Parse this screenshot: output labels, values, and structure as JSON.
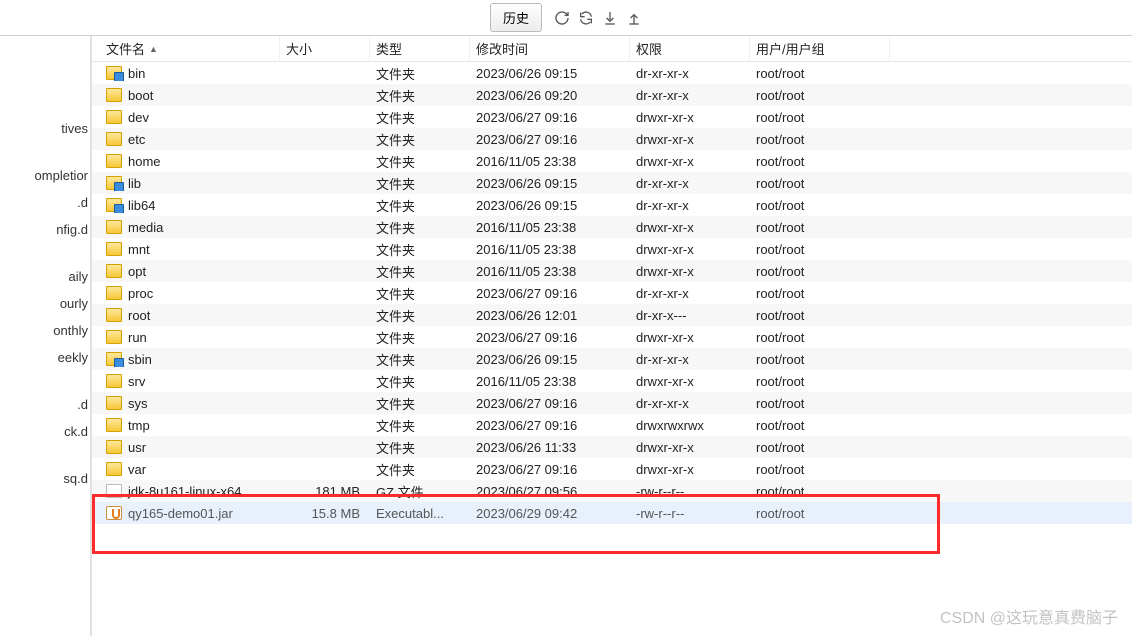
{
  "toolbar": {
    "history_label": "历史",
    "icons": [
      "refresh-icon",
      "sync-icon",
      "download-icon",
      "upload-icon"
    ]
  },
  "left_sidebar": {
    "items_top": [
      ""
    ],
    "items": [
      "tives",
      "",
      "ompletior",
      ".d",
      "nfig.d",
      "",
      "aily",
      "ourly",
      "onthly",
      "eekly",
      "",
      ".d",
      "ck.d",
      "",
      "sq.d"
    ]
  },
  "table": {
    "headers": {
      "name": "文件名",
      "size": "大小",
      "type": "类型",
      "date": "修改时间",
      "perm": "权限",
      "user": "用户/用户组"
    },
    "rows": [
      {
        "icon": "folder-link",
        "name": "bin",
        "size": "",
        "type": "文件夹",
        "date": "2023/06/26 09:15",
        "perm": "dr-xr-xr-x",
        "user": "root/root"
      },
      {
        "icon": "folder",
        "name": "boot",
        "size": "",
        "type": "文件夹",
        "date": "2023/06/26 09:20",
        "perm": "dr-xr-xr-x",
        "user": "root/root"
      },
      {
        "icon": "folder",
        "name": "dev",
        "size": "",
        "type": "文件夹",
        "date": "2023/06/27 09:16",
        "perm": "drwxr-xr-x",
        "user": "root/root"
      },
      {
        "icon": "folder",
        "name": "etc",
        "size": "",
        "type": "文件夹",
        "date": "2023/06/27 09:16",
        "perm": "drwxr-xr-x",
        "user": "root/root"
      },
      {
        "icon": "folder",
        "name": "home",
        "size": "",
        "type": "文件夹",
        "date": "2016/11/05 23:38",
        "perm": "drwxr-xr-x",
        "user": "root/root"
      },
      {
        "icon": "folder-link",
        "name": "lib",
        "size": "",
        "type": "文件夹",
        "date": "2023/06/26 09:15",
        "perm": "dr-xr-xr-x",
        "user": "root/root"
      },
      {
        "icon": "folder-link",
        "name": "lib64",
        "size": "",
        "type": "文件夹",
        "date": "2023/06/26 09:15",
        "perm": "dr-xr-xr-x",
        "user": "root/root"
      },
      {
        "icon": "folder",
        "name": "media",
        "size": "",
        "type": "文件夹",
        "date": "2016/11/05 23:38",
        "perm": "drwxr-xr-x",
        "user": "root/root"
      },
      {
        "icon": "folder",
        "name": "mnt",
        "size": "",
        "type": "文件夹",
        "date": "2016/11/05 23:38",
        "perm": "drwxr-xr-x",
        "user": "root/root"
      },
      {
        "icon": "folder",
        "name": "opt",
        "size": "",
        "type": "文件夹",
        "date": "2016/11/05 23:38",
        "perm": "drwxr-xr-x",
        "user": "root/root"
      },
      {
        "icon": "folder",
        "name": "proc",
        "size": "",
        "type": "文件夹",
        "date": "2023/06/27 09:16",
        "perm": "dr-xr-xr-x",
        "user": "root/root"
      },
      {
        "icon": "folder",
        "name": "root",
        "size": "",
        "type": "文件夹",
        "date": "2023/06/26 12:01",
        "perm": "dr-xr-x---",
        "user": "root/root"
      },
      {
        "icon": "folder",
        "name": "run",
        "size": "",
        "type": "文件夹",
        "date": "2023/06/27 09:16",
        "perm": "drwxr-xr-x",
        "user": "root/root"
      },
      {
        "icon": "folder-link",
        "name": "sbin",
        "size": "",
        "type": "文件夹",
        "date": "2023/06/26 09:15",
        "perm": "dr-xr-xr-x",
        "user": "root/root"
      },
      {
        "icon": "folder",
        "name": "srv",
        "size": "",
        "type": "文件夹",
        "date": "2016/11/05 23:38",
        "perm": "drwxr-xr-x",
        "user": "root/root"
      },
      {
        "icon": "folder",
        "name": "sys",
        "size": "",
        "type": "文件夹",
        "date": "2023/06/27 09:16",
        "perm": "dr-xr-xr-x",
        "user": "root/root"
      },
      {
        "icon": "folder",
        "name": "tmp",
        "size": "",
        "type": "文件夹",
        "date": "2023/06/27 09:16",
        "perm": "drwxrwxrwx",
        "user": "root/root"
      },
      {
        "icon": "folder",
        "name": "usr",
        "size": "",
        "type": "文件夹",
        "date": "2023/06/26 11:33",
        "perm": "drwxr-xr-x",
        "user": "root/root"
      },
      {
        "icon": "folder",
        "name": "var",
        "size": "",
        "type": "文件夹",
        "date": "2023/06/27 09:16",
        "perm": "drwxr-xr-x",
        "user": "root/root"
      },
      {
        "icon": "file",
        "name": "jdk-8u161-linux-x64",
        "size": "181 MB",
        "type": "GZ 文件",
        "date": "2023/06/27 09:56",
        "perm": "-rw-r--r--",
        "user": "root/root"
      },
      {
        "icon": "java",
        "name": "qy165-demo01.jar",
        "size": "15.8 MB",
        "type": "Executabl...",
        "date": "2023/06/29 09:42",
        "perm": "-rw-r--r--",
        "user": "root/root",
        "selected": true
      }
    ]
  },
  "watermark": "CSDN @这玩意真费脑子"
}
